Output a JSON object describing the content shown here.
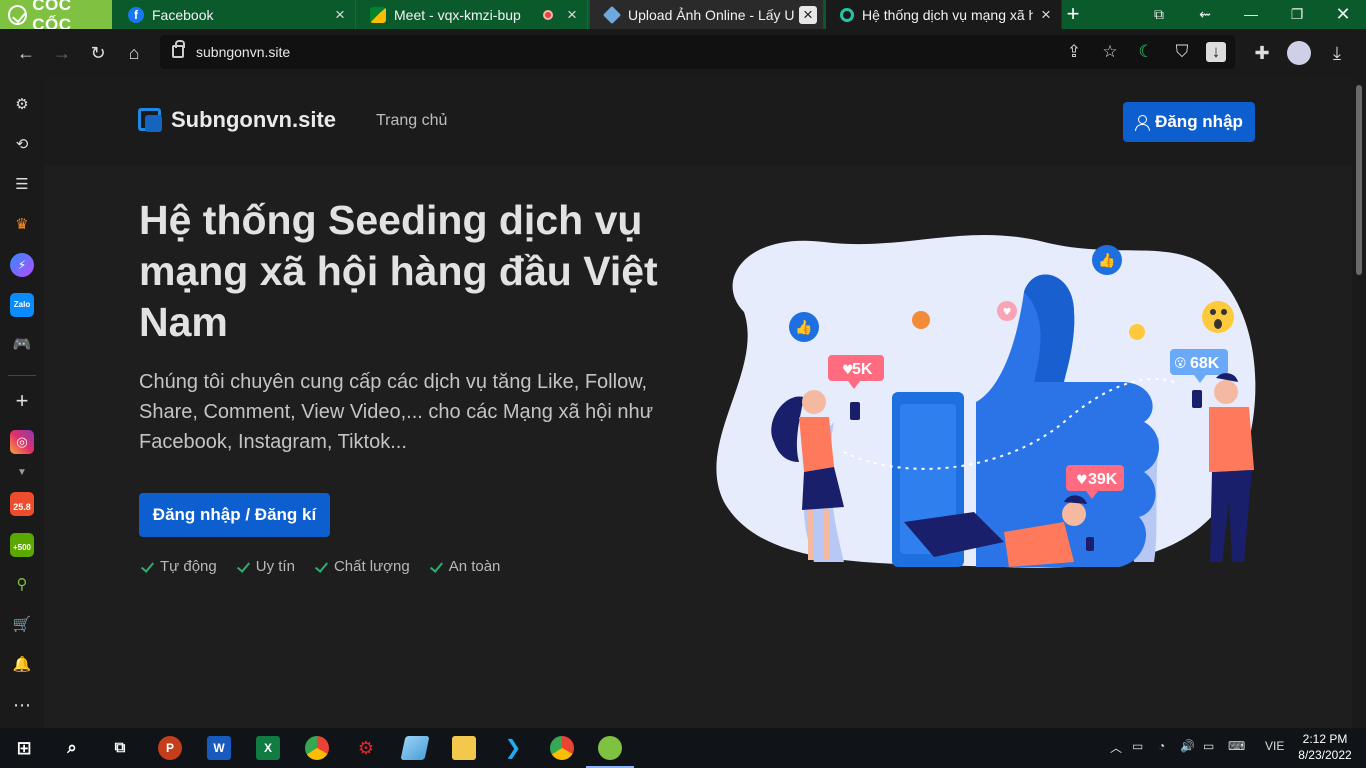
{
  "browser": {
    "brand": "CỐC CỐC",
    "tabs": [
      {
        "title": "Facebook",
        "favicon": "facebook-icon"
      },
      {
        "title": "Meet - vqx-kmzi-bup",
        "favicon": "google-meet-icon"
      },
      {
        "title": "Upload Ảnh Online - Lấy URL",
        "favicon": "diamond-icon"
      },
      {
        "title": "Hệ thống dịch vụ mạng xã h",
        "favicon": "site-icon",
        "active": true
      }
    ],
    "url": "subngonvn.site"
  },
  "site": {
    "brand": "Subngonvn.site",
    "nav_home": "Trang chủ",
    "login_label": "Đăng nhập",
    "hero_title": "Hệ thống Seeding dịch vụ mạng xã hội hàng đầu Việt Nam",
    "hero_desc": "Chúng tôi chuyên cung cấp các dịch vụ tăng Like, Follow, Share, Comment, View Video,... cho các Mạng xã hội như Facebook, Instagram, Tiktok...",
    "cta_label": "Đăng nhập / Đăng kí",
    "features": [
      "Tự động",
      "Uy tín",
      "Chất lượng",
      "An toàn"
    ],
    "badges": {
      "likes_5k": "5K",
      "views_68k": "68K",
      "hearts_39k": "39K"
    }
  },
  "sidebar_badges": {
    "shopee": "25.8",
    "coins": "+500"
  },
  "taskbar": {
    "time": "2:12 PM",
    "date": "8/23/2022",
    "lang": "VIE"
  },
  "colors": {
    "accent": "#0d5ecf",
    "check": "#29b26b",
    "brand_green": "#7fc242"
  }
}
